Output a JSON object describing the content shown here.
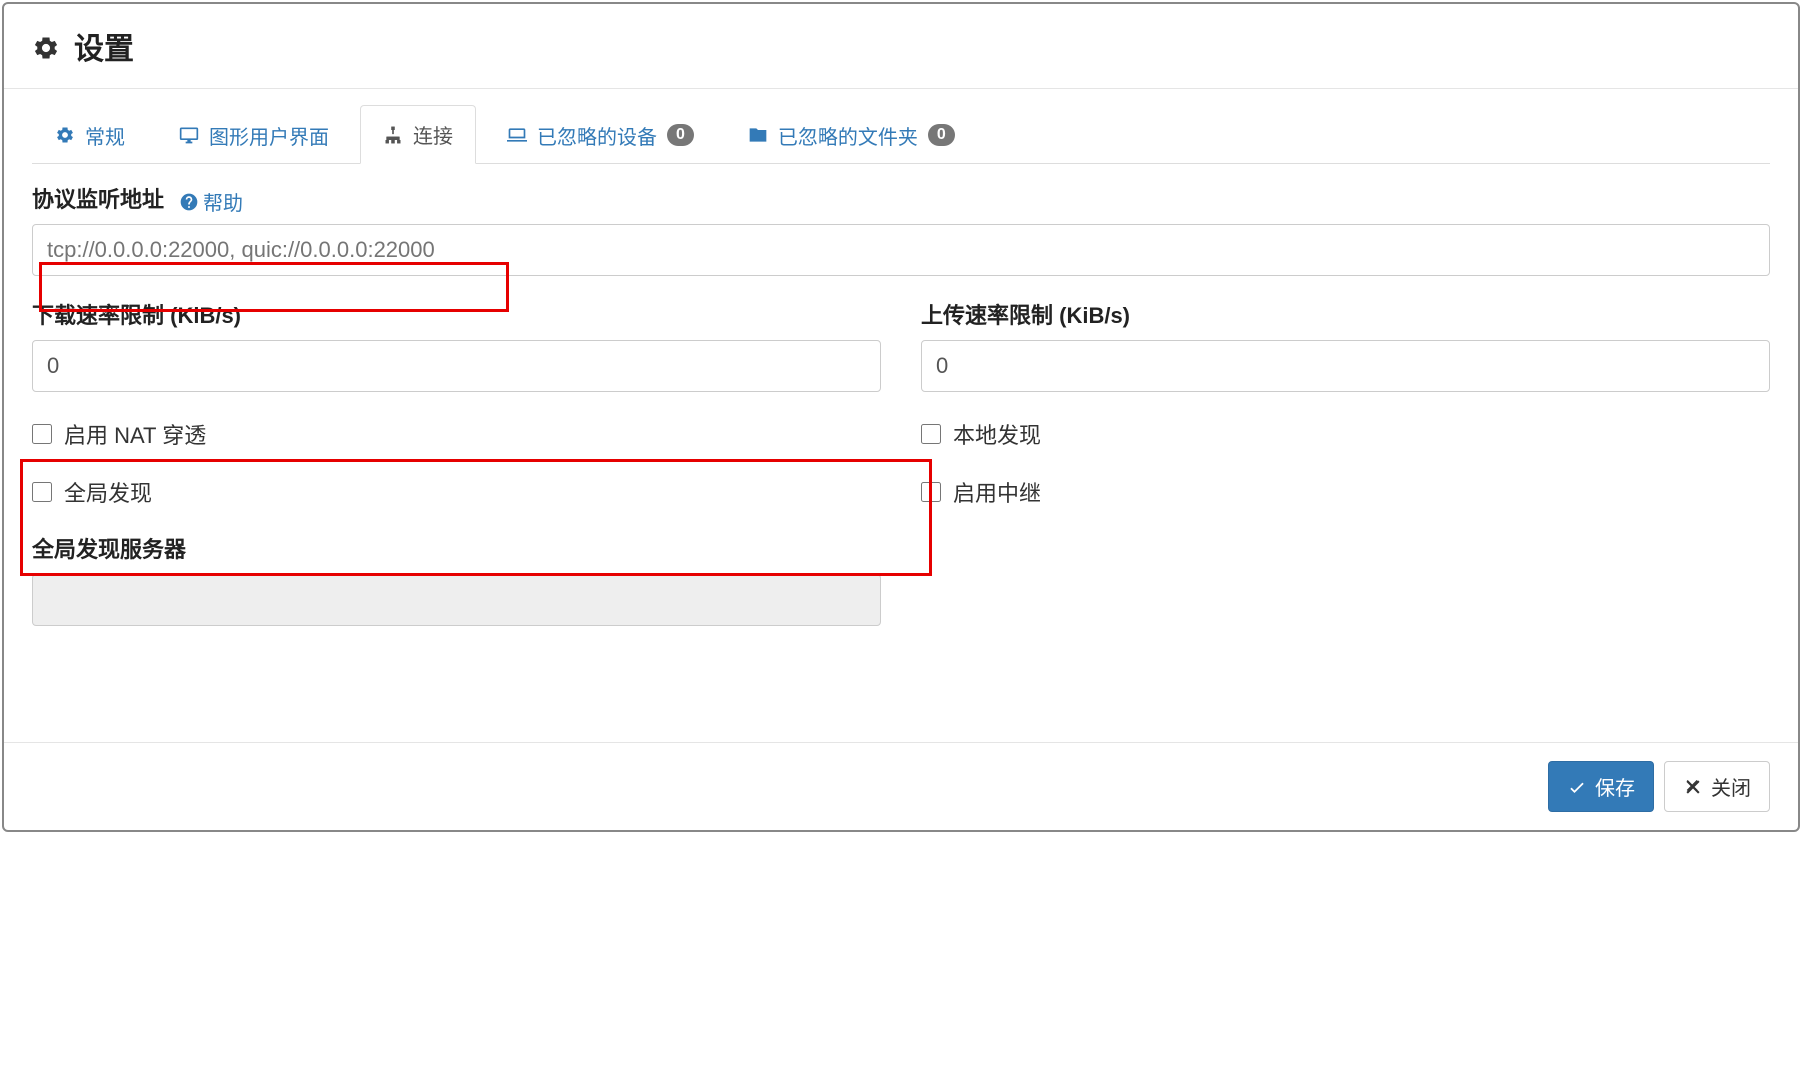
{
  "header": {
    "title": "设置"
  },
  "tabs": {
    "general": "常规",
    "gui": "图形用户界面",
    "connection": "连接",
    "ignored_devices": "已忽略的设备",
    "ignored_devices_count": "0",
    "ignored_folders": "已忽略的文件夹",
    "ignored_folders_count": "0"
  },
  "form": {
    "listen_label": "协议监听地址",
    "help_label": "帮助",
    "listen_placeholder": "tcp://0.0.0.0:22000, quic://0.0.0.0:22000",
    "download_rate_label": "下载速率限制 (KiB/s)",
    "download_rate_value": "0",
    "upload_rate_label": "上传速率限制 (KiB/s)",
    "upload_rate_value": "0",
    "nat_label": "启用 NAT 穿透",
    "local_discovery_label": "本地发现",
    "global_discovery_label": "全局发现",
    "relay_label": "启用中继",
    "global_discovery_servers_label": "全局发现服务器",
    "global_discovery_servers_value": ""
  },
  "footer": {
    "save": "保存",
    "close": "关闭"
  }
}
